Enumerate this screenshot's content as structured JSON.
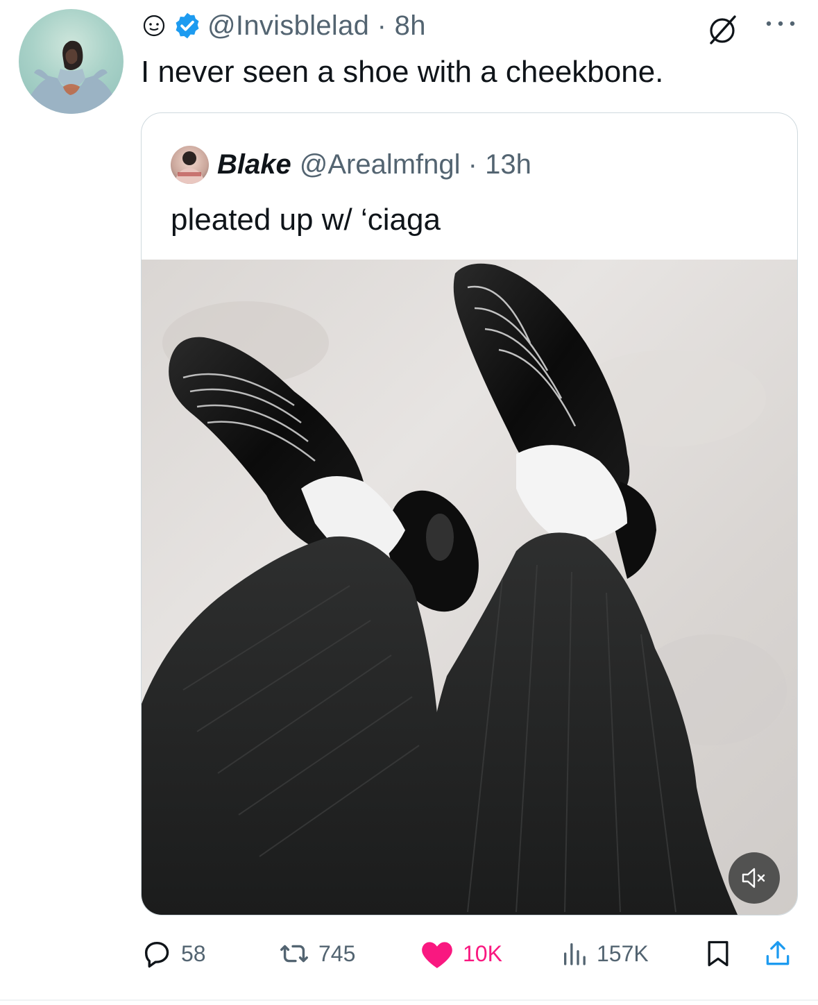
{
  "author": {
    "handle": "@Invisblelad",
    "time": "8h",
    "handle_time": "@Invisblelad · 8h",
    "verified": true,
    "avatar_icon": "user-avatar",
    "status_icon": "smiley-circle-icon"
  },
  "tweet": {
    "text": "I never seen a shoe with a cheekbone."
  },
  "quoted": {
    "name": "Blake",
    "handle": "@Arealmfngl",
    "time": "13h",
    "handle_time": "@Arealmfngl · 13h",
    "text": "pleated up w/ ‘ciaga",
    "media_icon": "video-thumbnail",
    "muted": true
  },
  "actions": {
    "replies": "58",
    "reposts": "745",
    "likes": "10K",
    "views": "157K",
    "liked": true
  },
  "colors": {
    "verified": "#1d9bf0",
    "like": "#f91880",
    "muted_text": "#536471",
    "border": "#cfd9de"
  }
}
